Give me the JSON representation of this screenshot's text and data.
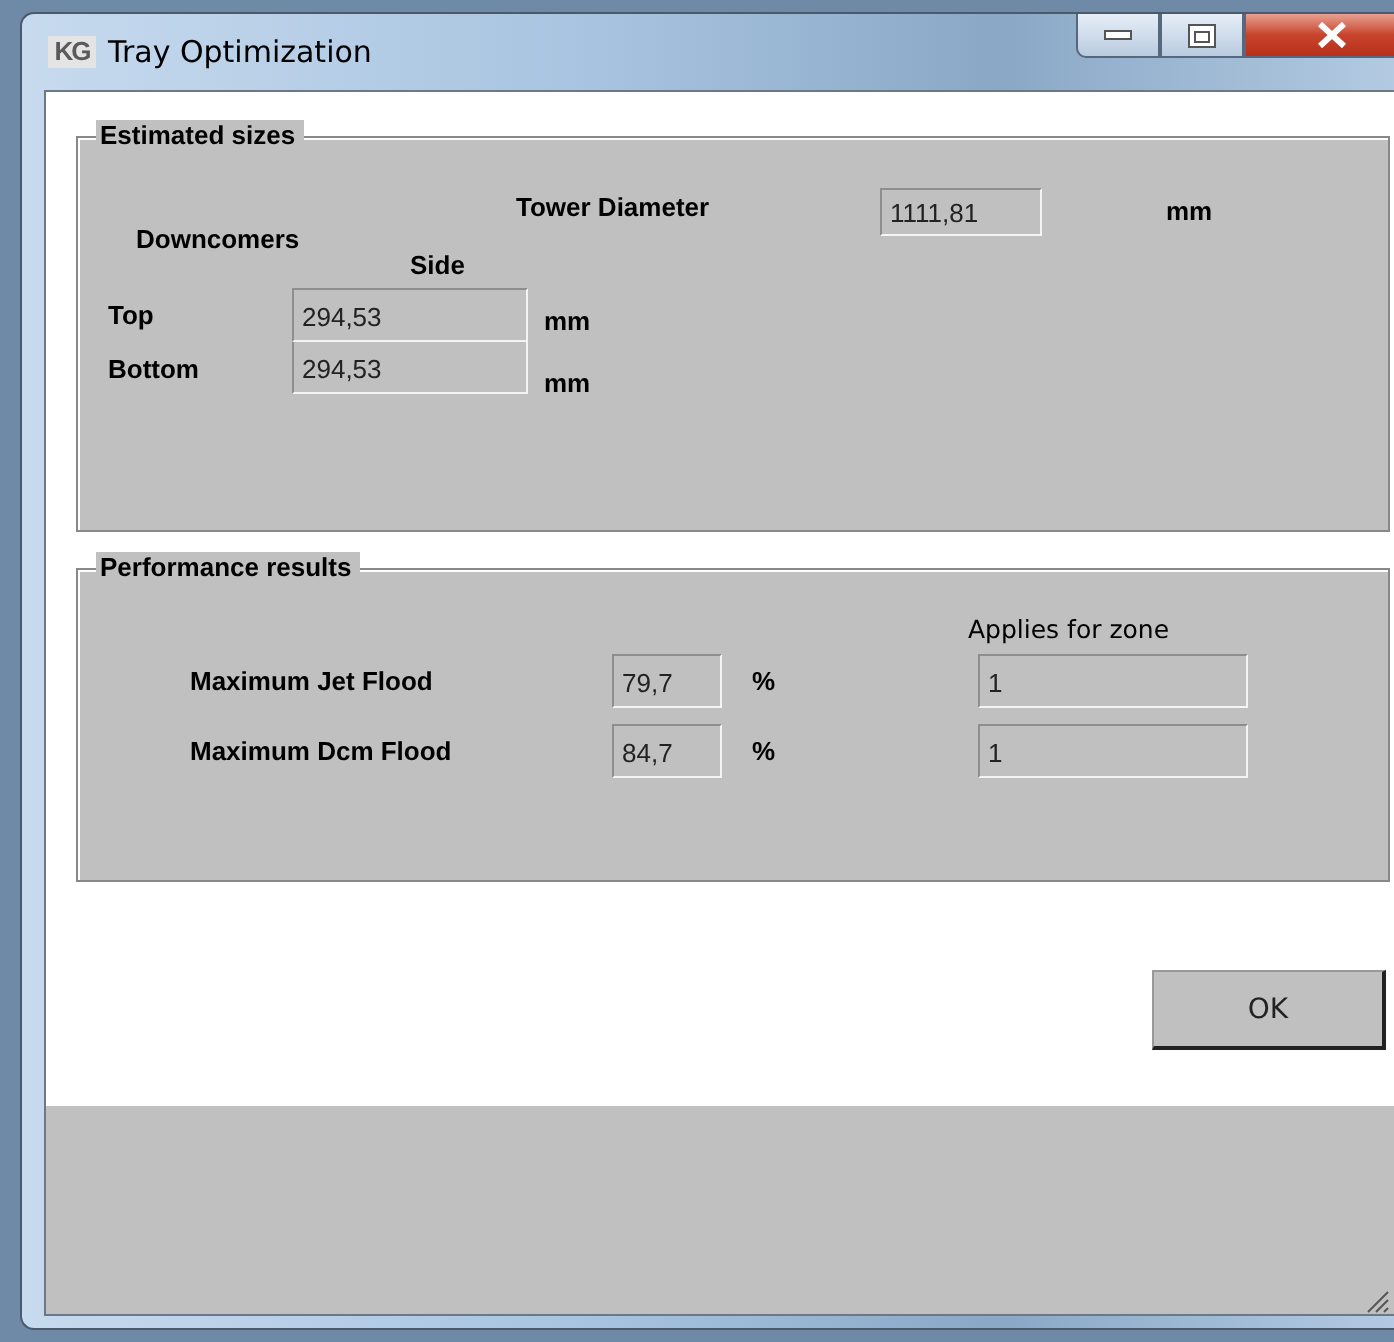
{
  "window": {
    "title": "Tray Optimization",
    "icon": "KG"
  },
  "estimated_sizes": {
    "title": "Estimated sizes",
    "tower_diameter": {
      "label": "Tower Diameter",
      "value": "1111,81",
      "unit": "mm"
    },
    "downcomers": {
      "label": "Downcomers",
      "column": "Side",
      "rows": [
        {
          "label": "Top",
          "value": "294,53",
          "unit": "mm"
        },
        {
          "label": "Bottom",
          "value": "294,53",
          "unit": "mm"
        }
      ]
    }
  },
  "performance_results": {
    "title": "Performance results",
    "zone_header": "Applies for zone",
    "rows": [
      {
        "label": "Maximum Jet Flood",
        "value": "79,7",
        "unit": "%",
        "zone": "1"
      },
      {
        "label": "Maximum Dcm Flood",
        "value": "84,7",
        "unit": "%",
        "zone": "1"
      }
    ]
  },
  "buttons": [
    {
      "label": "OK"
    }
  ]
}
